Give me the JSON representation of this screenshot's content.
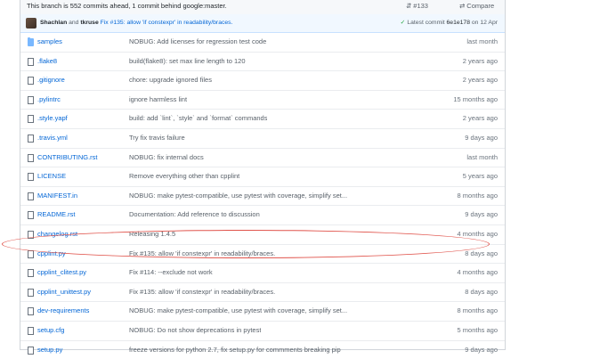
{
  "branch_status": "This branch is 552 commits ahead, 1 commit behind google:master.",
  "pull_request": "#133",
  "compare_label": "Compare",
  "latest_commit": {
    "authors": "Shachlan",
    "and_text": "and",
    "coauthor": "tkruse",
    "message": "Fix #135: allow 'if constexpr' in readability/braces.",
    "latest_label": "Latest commit",
    "sha": "6e1e178",
    "date": "on 12 Apr"
  },
  "files": [
    {
      "type": "dir",
      "name": "samples",
      "message": "NOBUG: Add licenses for regression test code",
      "age": "last month"
    },
    {
      "type": "file",
      "name": ".flake8",
      "message": "build(flake8): set max line length to 120",
      "age": "2 years ago"
    },
    {
      "type": "file",
      "name": ".gitignore",
      "message": "chore: upgrade ignored files",
      "age": "2 years ago"
    },
    {
      "type": "file",
      "name": ".pylintrc",
      "message": "ignore harmless lint",
      "age": "15 months ago"
    },
    {
      "type": "file",
      "name": ".style.yapf",
      "message": "build: add `lint`, `style` and `format` commands",
      "age": "2 years ago"
    },
    {
      "type": "file",
      "name": ".travis.yml",
      "message": "Try fix travis failure",
      "age": "9 days ago"
    },
    {
      "type": "file",
      "name": "CONTRIBUTING.rst",
      "message": "NOBUG: fix internal docs",
      "age": "last month"
    },
    {
      "type": "file",
      "name": "LICENSE",
      "message": "Remove everything other than cpplint",
      "age": "5 years ago"
    },
    {
      "type": "file",
      "name": "MANIFEST.in",
      "message": "NOBUG: make pytest-compatible, use pytest with coverage, simplify set...",
      "age": "8 months ago"
    },
    {
      "type": "file",
      "name": "README.rst",
      "message": "Documentation: Add reference to discussion",
      "age": "9 days ago"
    },
    {
      "type": "file",
      "name": "changelog.rst",
      "message": "Releasing 1.4.5",
      "age": "4 months ago"
    },
    {
      "type": "file",
      "name": "cpplint.py",
      "message": "Fix #135: allow 'if constexpr' in readability/braces.",
      "age": "8 days ago"
    },
    {
      "type": "file",
      "name": "cpplint_clitest.py",
      "message": "Fix #114: --exclude not work",
      "age": "4 months ago"
    },
    {
      "type": "file",
      "name": "cpplint_unittest.py",
      "message": "Fix #135: allow 'if constexpr' in readability/braces.",
      "age": "8 days ago"
    },
    {
      "type": "file",
      "name": "dev-requirements",
      "message": "NOBUG: make pytest-compatible, use pytest with coverage, simplify set...",
      "age": "8 months ago"
    },
    {
      "type": "file",
      "name": "setup.cfg",
      "message": "NOBUG: Do not show deprecations in pytest",
      "age": "5 months ago"
    },
    {
      "type": "file",
      "name": "setup.py",
      "message": "freeze versions for python 2.7, fix setup.py for commments breaking pip",
      "age": "9 days ago"
    }
  ]
}
